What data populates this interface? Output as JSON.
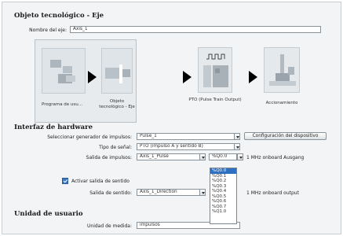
{
  "sections": {
    "object": "Objeto tecnológico - Eje",
    "hardware": "Interfaz de hardware",
    "user_unit": "Unidad de usuario"
  },
  "axis_name": {
    "label": "Nombre del eje:",
    "value": "Axis_1"
  },
  "diagram": {
    "items": [
      {
        "label": "Programa de usu..."
      },
      {
        "label": "Objeto tecnológico - Eje"
      },
      {
        "label": "PTO (Pulse Train Output)"
      },
      {
        "label": "Accionamiento"
      }
    ]
  },
  "hardware": {
    "pulse_gen": {
      "label": "Seleccionar generador de impulsos:",
      "value": "Pulse_1"
    },
    "device_config_button": "Configuración del dispositivo",
    "signal_type": {
      "label": "Tipo de señal:",
      "value": "PTO (impulso A y sentido B)"
    },
    "pulse_output": {
      "label": "Salida de impulsos:",
      "value": "Axis_1_Pulse",
      "address": "%Q0.0",
      "note": "1 MHz onboard Ausgang"
    },
    "activate_direction": {
      "label": "Activar salida de sentido",
      "checked": true
    },
    "direction_output": {
      "label": "Salida de sentido:",
      "value": "Axis_1_Direction",
      "note": "1 MHz onboard output"
    }
  },
  "address_options": [
    "%Q0.0",
    "%Q0.1",
    "%Q0.2",
    "%Q0.3",
    "%Q0.4",
    "%Q0.5",
    "%Q0.6",
    "%Q0.7",
    "%Q1.0"
  ],
  "user_unit": {
    "measure": {
      "label": "Unidad de medida:",
      "value": "impulsos"
    }
  },
  "colors": {
    "accent": "#2f6fc0",
    "panel": "#f2f4f6",
    "border": "#8a9299"
  }
}
